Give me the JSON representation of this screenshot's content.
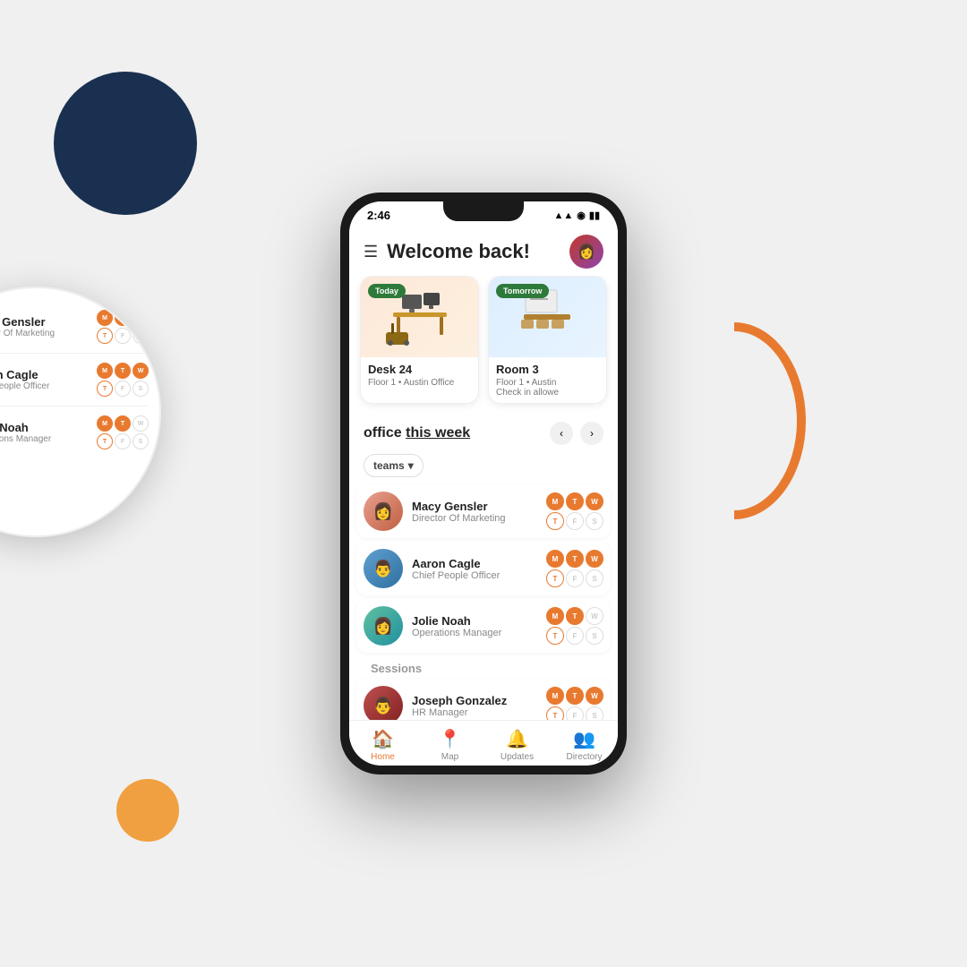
{
  "decorations": {
    "darkCircle": "dark navy circle decoration",
    "orangeCircle": "orange circle decoration",
    "orangeArc": "orange arc decoration"
  },
  "phone": {
    "statusBar": {
      "time": "2:46",
      "icons": "▲▲ ◉ ▮▮"
    },
    "header": {
      "title": "Welcome back!",
      "menuIcon": "☰"
    },
    "bookingCards": [
      {
        "badge": "Today",
        "name": "Desk 24",
        "sub": "Floor 1 • Austin Office"
      },
      {
        "badge": "Tomorrow",
        "name": "Room 3",
        "sub": "Floor 1 • Austin\nCheck in allowe"
      }
    ],
    "officeSection": {
      "title": "office",
      "titleUnderline": "this week"
    },
    "teamsFilter": "teams",
    "people": [
      {
        "name": "Macy Gensler",
        "role": "Director Of Marketing",
        "days": [
          "M",
          "T",
          "W",
          "T",
          "F",
          "S"
        ],
        "filledDays": [
          0,
          1,
          2
        ]
      },
      {
        "name": "Aaron Cagle",
        "role": "Chief People Officer",
        "days": [
          "M",
          "T",
          "W",
          "T",
          "F",
          "S"
        ],
        "filledDays": [
          0,
          1,
          2
        ]
      },
      {
        "name": "Jolie Noah",
        "role": "Operations Manager",
        "days": [
          "M",
          "T",
          "W",
          "T",
          "F",
          "S"
        ],
        "filledDays": [
          0,
          1
        ]
      },
      {
        "name": "Joseph Gonzalez",
        "role": "HR Manager",
        "days": [
          "M",
          "T",
          "W",
          "T",
          "F",
          "S"
        ],
        "filledDays": [
          0,
          1,
          2
        ]
      }
    ],
    "sessionsLabel": "Sessions",
    "bottomNav": [
      {
        "icon": "🏠",
        "label": "Home",
        "active": true
      },
      {
        "icon": "📍",
        "label": "Map",
        "active": false
      },
      {
        "icon": "🔔",
        "label": "Updates",
        "active": false
      },
      {
        "icon": "👥",
        "label": "Directory",
        "active": false
      }
    ]
  },
  "magnifyPeople": [
    {
      "name": "Macy Gensler",
      "role": "Director Of Marketing",
      "days": [
        "M",
        "T",
        "W",
        "T",
        "F",
        "S"
      ],
      "filledDays": [
        0,
        1,
        2
      ]
    },
    {
      "name": "Aaron Cagle",
      "role": "Chief People Officer",
      "days": [
        "M",
        "T",
        "W",
        "T",
        "F",
        "S"
      ],
      "filledDays": [
        0,
        1,
        2
      ]
    },
    {
      "name": "Jolie Noah",
      "role": "Operations Manager",
      "days": [
        "M",
        "T",
        "W",
        "T",
        "F",
        "S"
      ],
      "filledDays": [
        0,
        1
      ]
    }
  ]
}
